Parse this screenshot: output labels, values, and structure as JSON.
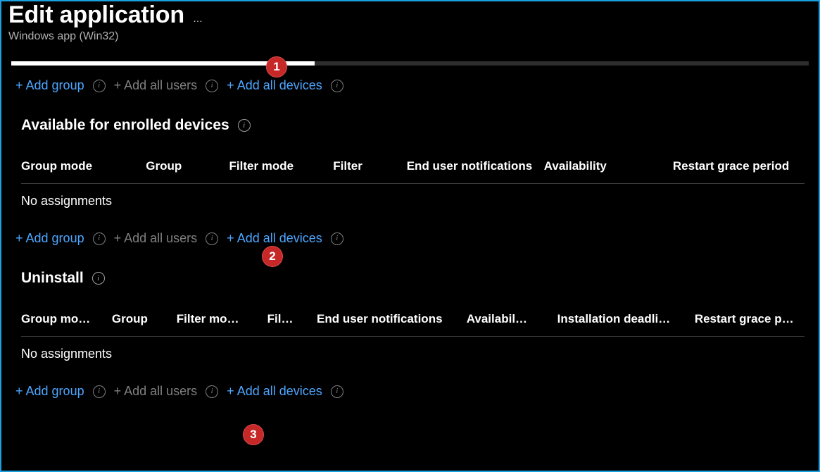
{
  "header": {
    "title": "Edit application",
    "ellipsis": "…",
    "subtitle": "Windows app (Win32)"
  },
  "actions": {
    "add_group": "+ Add group",
    "add_all_users": "+ Add all users",
    "add_all_devices": "+ Add all devices"
  },
  "sections": {
    "available": {
      "title": "Available for enrolled devices",
      "columns": {
        "c1": "Group mode",
        "c2": "Group",
        "c3": "Filter mode",
        "c4": "Filter",
        "c5": "End user notifications",
        "c6": "Availability",
        "c7": "Restart grace period"
      },
      "empty_text": "No assignments"
    },
    "uninstall": {
      "title": "Uninstall",
      "columns": {
        "c1": "Group mo…",
        "c2": "Group",
        "c3": "Filter mo…",
        "c4": "Fil…",
        "c5": "End user notifications",
        "c6": "Availabil…",
        "c7": "Installation deadli…",
        "c8": "Restart grace p…"
      },
      "empty_text": "No assignments"
    }
  },
  "callouts": {
    "one": "1",
    "two": "2",
    "three": "3"
  }
}
